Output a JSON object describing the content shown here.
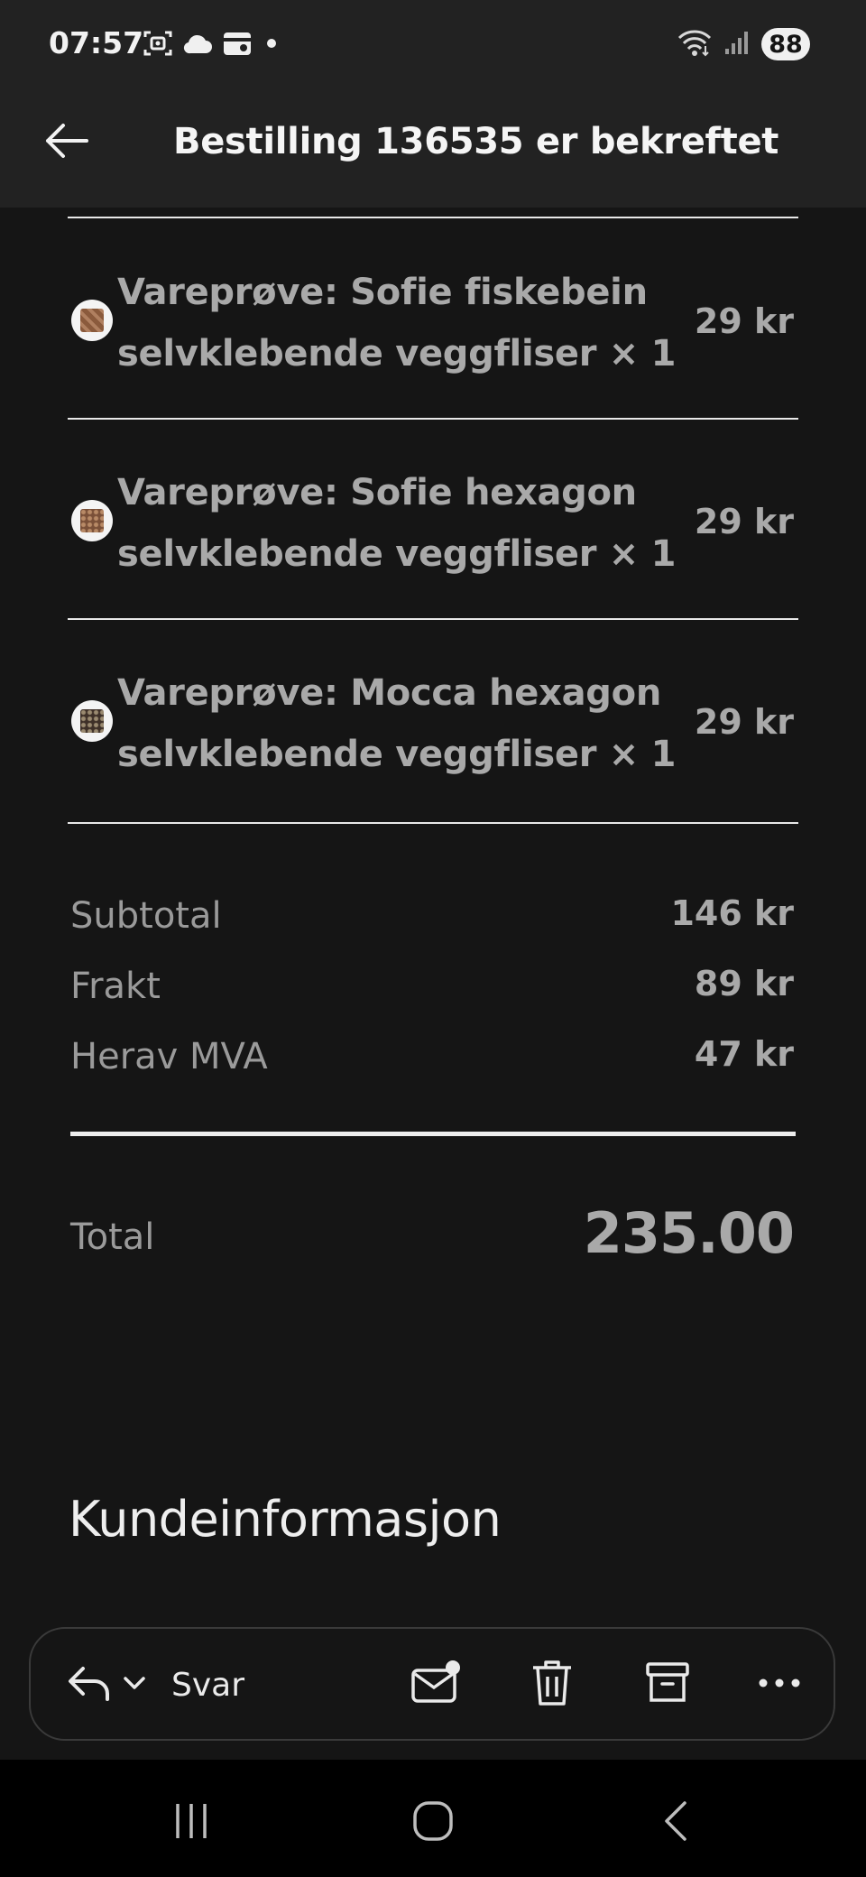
{
  "status_bar": {
    "time": "07:57",
    "battery": "88",
    "left_icons": [
      "screenshot-icon",
      "cloud-icon",
      "wallet-icon",
      "dot-icon"
    ],
    "right_icons": [
      "wifi-icon",
      "signal-icon"
    ]
  },
  "app_bar": {
    "title": "Bestilling 136535 er bekreftet",
    "back_icon": "arrow-left-icon"
  },
  "order_items": [
    {
      "name": "Vareprøve: Sofie fiskebein selvklebende veggfliser × 1",
      "price": "29 kr",
      "swatch_color": "#8a5a3c"
    },
    {
      "name": "Vareprøve: Sofie hexagon selvklebende veggfliser × 1",
      "price": "29 kr",
      "swatch_color": "#9a6a4a"
    },
    {
      "name": "Vareprøve: Mocca hexagon selvklebende veggfliser × 1",
      "price": "29 kr",
      "swatch_color": "#5a4a3e"
    }
  ],
  "summary": [
    {
      "label": "Subtotal",
      "value": "146 kr"
    },
    {
      "label": "Frakt",
      "value": "89 kr"
    },
    {
      "label": "Herav MVA",
      "value": "47 kr"
    }
  ],
  "total": {
    "label": "Total",
    "value": "235.00"
  },
  "customer_section": {
    "heading": "Kundeinformasjon"
  },
  "action_bar": {
    "reply_label": "Svar",
    "icons": [
      "reply-icon",
      "chevron-down-icon",
      "mark-unread-icon",
      "trash-icon",
      "archive-icon",
      "more-icon"
    ]
  },
  "nav_bar": {
    "icons": [
      "recent-apps-icon",
      "home-icon",
      "back-icon"
    ]
  },
  "colors": {
    "background": "#151515",
    "app_bar": "#222222",
    "muted_text": "#a9a9a9",
    "divider": "#e8e8e8"
  }
}
